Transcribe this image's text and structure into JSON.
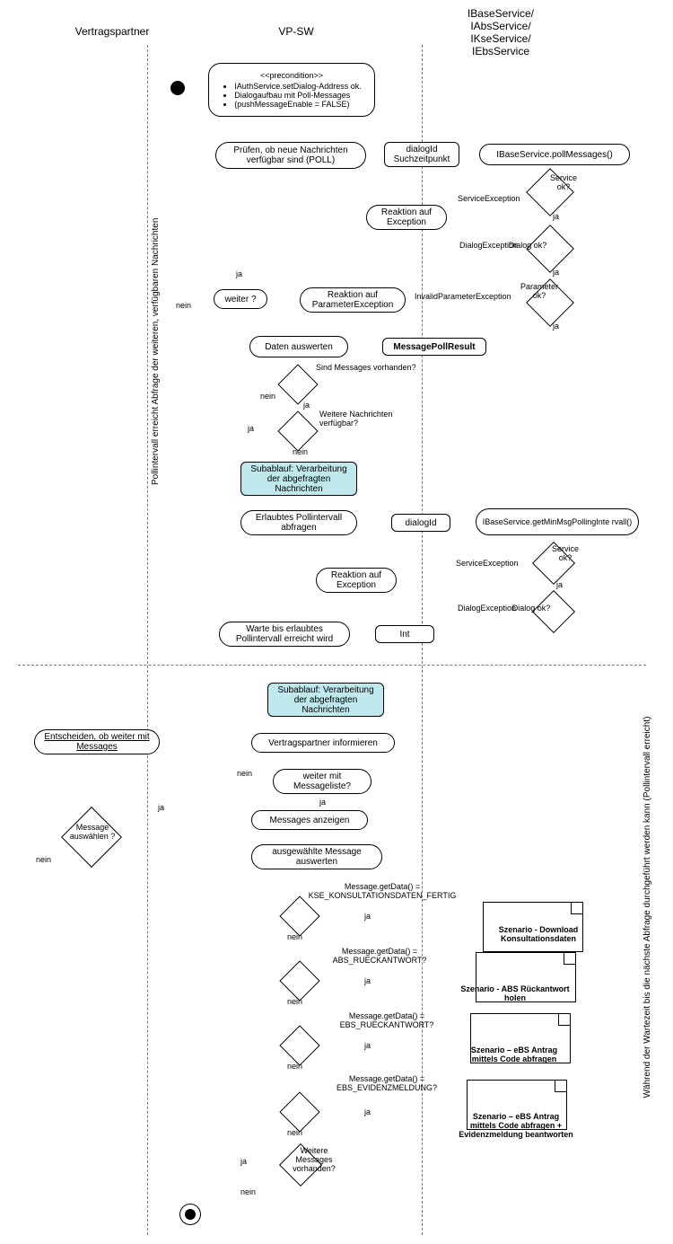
{
  "lanes": {
    "l1": "Vertragspartner",
    "l2": "VP-SW",
    "l3": "IBaseService/\nIAbsService/\nIKseService/\nIEbsService"
  },
  "precond": {
    "header": "<<precondition>>",
    "items": [
      "IAuthService.setDialog-Address ok.",
      "Dialogaufbau mit Poll-Messages",
      "(pushMessageEnable = FALSE)"
    ]
  },
  "n": {
    "poll_check": "Prüfen, ob neue Nachrichten\nverfügbar sind (POLL)",
    "call1": "IBaseService.pollMessages()",
    "react_ex1": "Reaktion auf\nException",
    "react_param": "Reaktion auf\nParameterException",
    "weiter": "weiter ?",
    "daten_ausw": "Daten auswerten",
    "sub1": "Subablauf: Verarbeitung\nder abgefragten\nNachrichten",
    "poll_intvl": "Erlaubtes Pollintervall\nabfragen",
    "call2": "IBaseService.getMinMsgPollingInte\nrvall()",
    "react_ex2": "Reaktion auf\nException",
    "warte": "Warte bis erlaubtes\nPollintervall erreicht wird",
    "sub2": "Subablauf: Verarbeitung\nder abgefragten\nNachrichten",
    "inform": "Vertragspartner informieren",
    "entscheiden": "Entscheiden, ob weiter mit\nMessages",
    "weiter_list": "weiter mit\nMessageliste?",
    "msg_anzeigen": "Messages anzeigen",
    "msg_ausw": "Message\nauswählen ?",
    "msg_eval": "ausgewählte Message\nauswerten",
    "weitere": "Weitere\nMessages\nvorhanden?"
  },
  "flow": {
    "dialogId_such": "dialogId\nSuchzeitpunkt",
    "svc_ok": "Service\nok?",
    "dlg_ok": "Dialog ok?",
    "par_ok": "Parameter\nok?",
    "svc_ex": "ServiceException",
    "dlg_ex": "DialogException",
    "inv_par": "InvalidParameterException",
    "mpr": "MessagePollResult",
    "msg_vorh": "Sind Messages vorhanden?",
    "weitere_nachr": "Weitere Nachrichten\nverfügbar?",
    "dialogId": "dialogId",
    "int": "Int",
    "ja": "ja",
    "nein": "nein"
  },
  "cond": {
    "c1": "Message.getData() =\nKSE_KONSULTATIONSDATEN_FERTIG",
    "c2": "Message.getData() =\nABS_RUECKANTWORT?",
    "c3": "Message.getData() =\nEBS_RUECKANTWORT?",
    "c4": "Message.getData() =\nEBS_EVIDENZMELDUNG?"
  },
  "scen": {
    "s1": "Szenario - Download\nKonsultationsdaten",
    "s2": "Szenario - ABS Rückantwort\nholen",
    "s3": "Szenario – eBS Antrag\nmittels Code abfragen",
    "s4": "Szenario – eBS Antrag\nmittels Code abfragen +\nEvidenzmeldung beantworten"
  },
  "side": {
    "left_upper": "Pollintervall erreicht     Abfrage der weiteren, verfügbaren Nachrichten",
    "right_brace": "Während der Wartezeit bis die nächste Abfrage durchgeführt werden kann\n(Pollintervall erreicht)"
  }
}
